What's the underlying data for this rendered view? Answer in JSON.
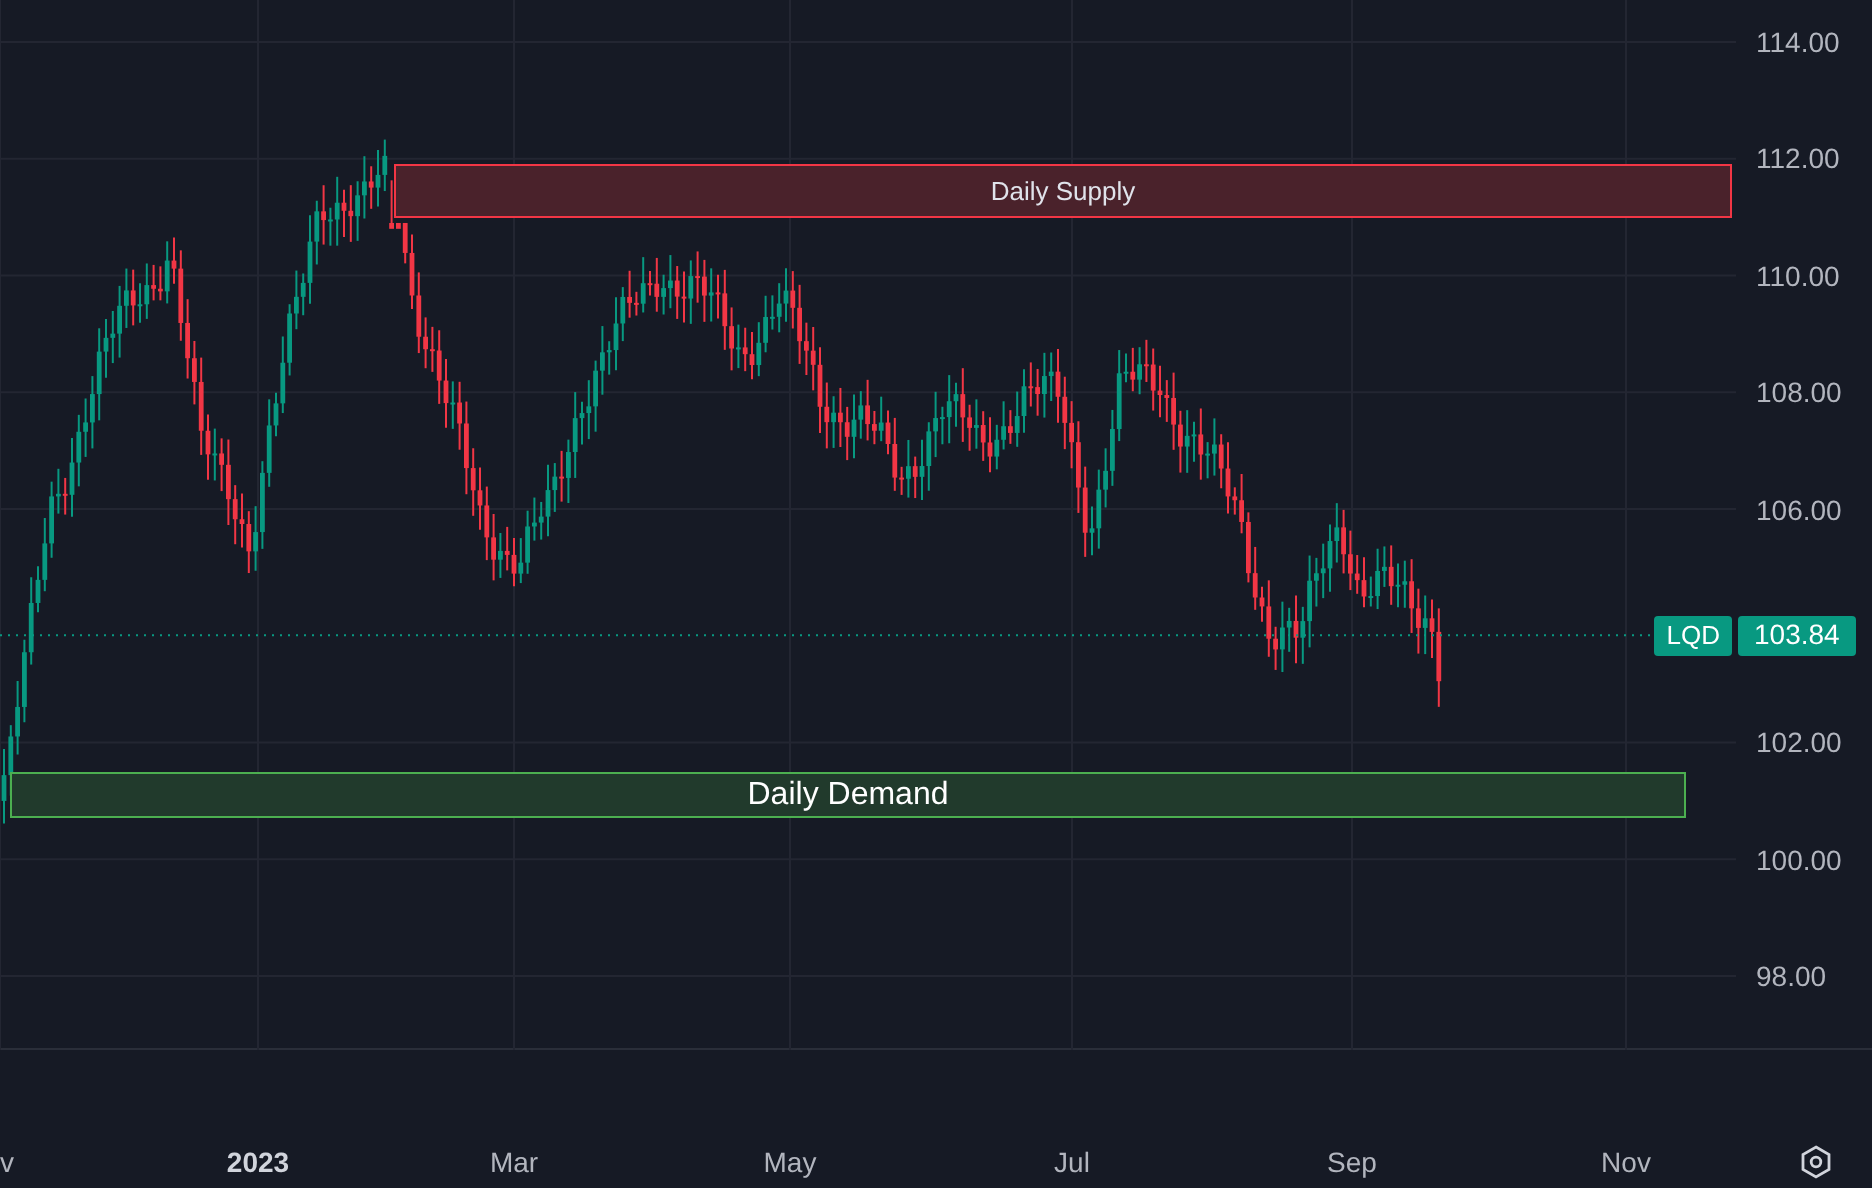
{
  "price_axis": {
    "ticks": [
      "114.00",
      "112.00",
      "110.00",
      "108.00",
      "106.00",
      "102.00",
      "100.00",
      "98.00"
    ]
  },
  "last_price": {
    "symbol": "LQD",
    "value": "103.84"
  },
  "zones": [
    {
      "kind": "supply",
      "label": "Daily Supply"
    },
    {
      "kind": "demand",
      "label": "Daily Demand"
    }
  ],
  "time_axis": {
    "labels": [
      {
        "text": "v",
        "kind": "month"
      },
      {
        "text": "2023",
        "kind": "year"
      },
      {
        "text": "Mar",
        "kind": "month"
      },
      {
        "text": "May",
        "kind": "month"
      },
      {
        "text": "Jul",
        "kind": "month"
      },
      {
        "text": "Sep",
        "kind": "month"
      },
      {
        "text": "Nov",
        "kind": "month"
      }
    ]
  }
}
